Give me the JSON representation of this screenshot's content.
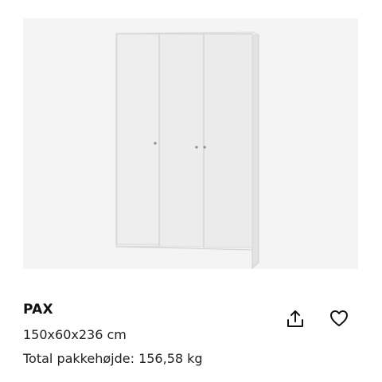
{
  "product": {
    "name": "PAX",
    "dimensions": "150x60x236 cm",
    "weight_line": "Total pakkehøjde: 156,58 kg"
  },
  "icons": {
    "share": "share-upload-icon",
    "favorite": "heart-outline-icon"
  },
  "colors": {
    "image_background": "#f4f4f4",
    "wardrobe_front": "#ececec",
    "wardrobe_side": "#e3e3e3",
    "text_primary": "#111111"
  }
}
